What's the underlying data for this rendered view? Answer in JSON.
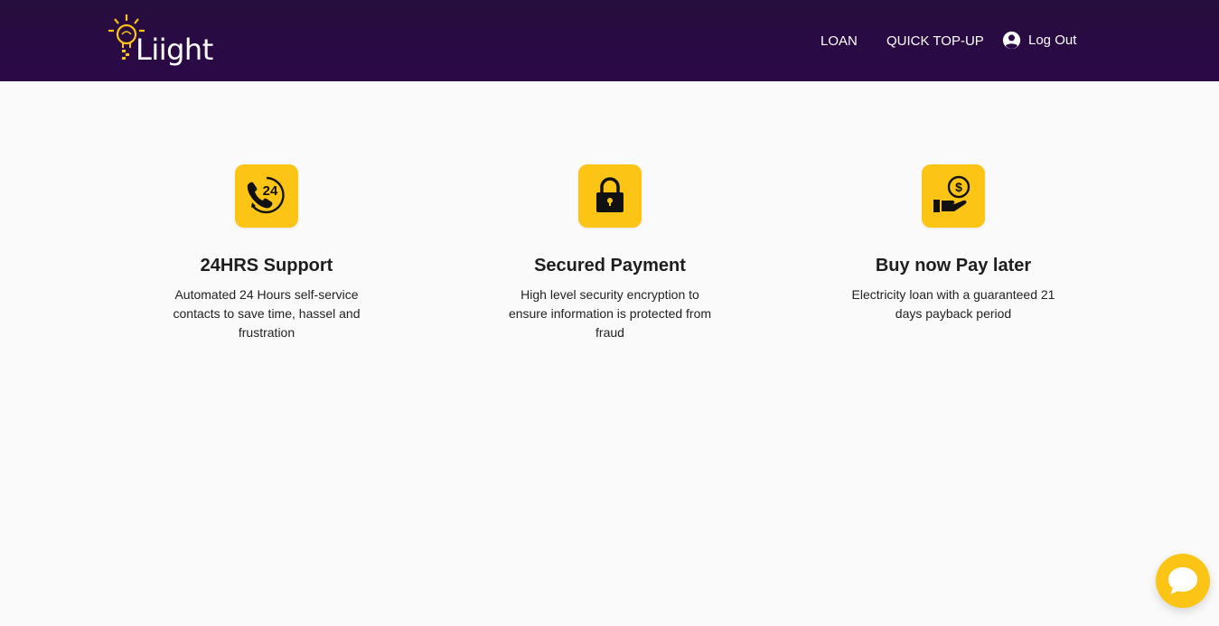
{
  "header": {
    "logo_text": "Liight",
    "nav": {
      "loan": "LOAN",
      "quick_topup": "QUICK TOP-UP",
      "logout": "Log Out"
    }
  },
  "features": [
    {
      "icon": "24-hour-phone-icon",
      "title": "24HRS Support",
      "description": "Automated 24 Hours self-service contacts to save time, hassel and frustration"
    },
    {
      "icon": "padlock-icon",
      "title": "Secured Payment",
      "description": "High level security encryption to ensure information is protected from fraud"
    },
    {
      "icon": "hand-coin-icon",
      "title": "Buy now Pay later",
      "description": "Electricity loan with a guaranteed 21 days payback period"
    }
  ],
  "chat": {
    "icon": "chat-bubble-icon"
  },
  "colors": {
    "header_bg": "#2b0847",
    "accent": "#fcc515",
    "page_bg": "#fafafa"
  }
}
